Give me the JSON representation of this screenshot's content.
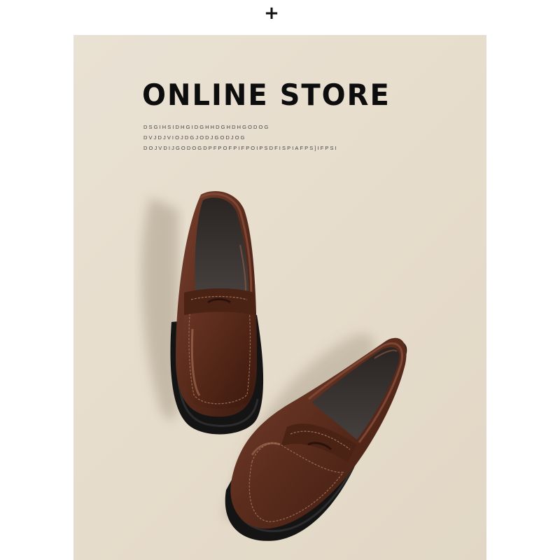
{
  "header": {
    "plus_symbol": "+"
  },
  "banner": {
    "title": "ONLINE STORE",
    "lines": [
      "DSGIHSIDHGIDGHHDGHDHGODOG",
      "DVJDJVIOJDGJODJGODJOG",
      "DOJVDIJGODOGDPFPOFPIFPOIPSDFISPIAFPS]IFPSI"
    ]
  },
  "colors": {
    "background": "#ffffff",
    "panel": "#e8e0d1",
    "shoe_leather": "#5a2e1e",
    "sole": "#151515",
    "title": "#0d0d0d"
  },
  "photo": {
    "subject": "pair of brown leather penny loafers with chunky black soles"
  }
}
